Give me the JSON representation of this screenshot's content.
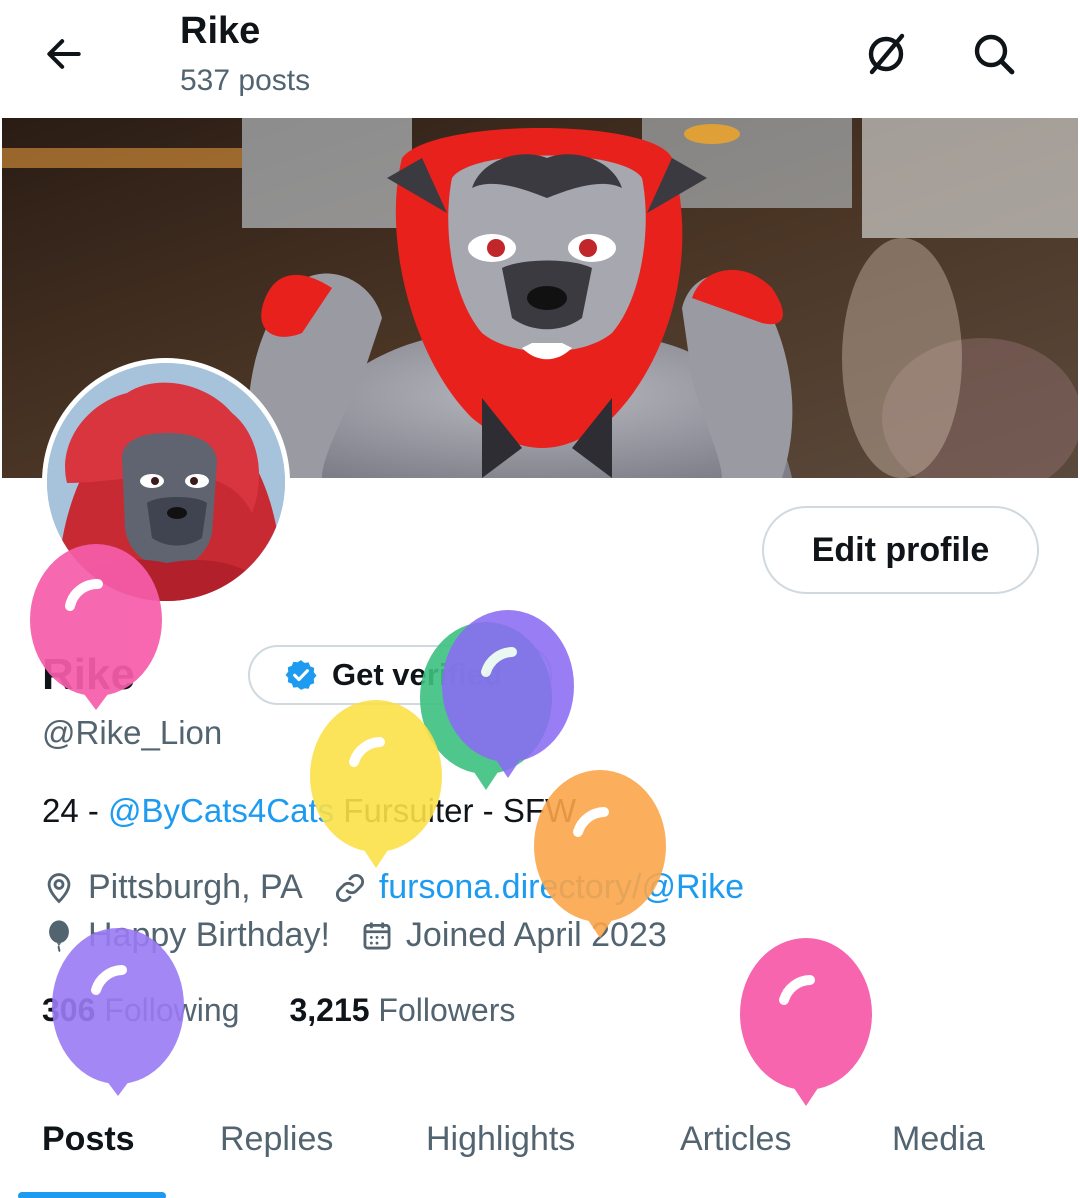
{
  "header": {
    "title": "Rike",
    "post_count": "537 posts",
    "back_icon": "arrow-left-icon",
    "icons": [
      "grok-icon",
      "search-icon"
    ]
  },
  "profile": {
    "name": "Rike",
    "handle": "@Rike_Lion",
    "edit_label": "Edit profile",
    "verify_label": "Get verified",
    "bio_prefix": "24 - ",
    "bio_mention": "@ByCats4Cats",
    "bio_suffix": " Fursuiter - SFW",
    "location": "Pittsburgh, PA",
    "website": "fursona.directory/@Rike",
    "birthday": "Happy Birthday!",
    "joined": "Joined April 2023"
  },
  "stats": {
    "following_count": "306",
    "following_label": "Following",
    "followers_count": "3,215",
    "followers_label": "Followers"
  },
  "tabs": [
    "Posts",
    "Replies",
    "Highlights",
    "Articles",
    "Media"
  ],
  "colors": {
    "accent": "#1d9bf0",
    "text": "#0f1419",
    "muted": "#536471",
    "suit_red": "#e8211c",
    "suit_gray": "#8f8f98",
    "balloon_pink": "#f65daa",
    "balloon_purple": "#9a7cf5",
    "balloon_yellow": "#fbe049",
    "balloon_green": "#3cc07f",
    "balloon_orange": "#fba64a"
  }
}
